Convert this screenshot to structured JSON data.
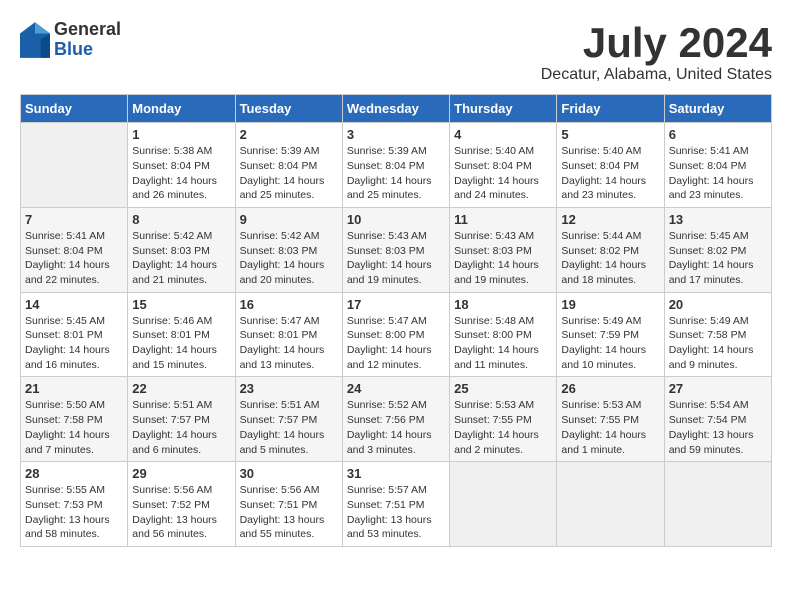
{
  "header": {
    "logo": {
      "general": "General",
      "blue": "Blue"
    },
    "title": "July 2024",
    "location": "Decatur, Alabama, United States"
  },
  "columns": [
    "Sunday",
    "Monday",
    "Tuesday",
    "Wednesday",
    "Thursday",
    "Friday",
    "Saturday"
  ],
  "weeks": [
    [
      {
        "day": "",
        "empty": true
      },
      {
        "day": "1",
        "sunrise": "Sunrise: 5:38 AM",
        "sunset": "Sunset: 8:04 PM",
        "daylight": "Daylight: 14 hours and 26 minutes."
      },
      {
        "day": "2",
        "sunrise": "Sunrise: 5:39 AM",
        "sunset": "Sunset: 8:04 PM",
        "daylight": "Daylight: 14 hours and 25 minutes."
      },
      {
        "day": "3",
        "sunrise": "Sunrise: 5:39 AM",
        "sunset": "Sunset: 8:04 PM",
        "daylight": "Daylight: 14 hours and 25 minutes."
      },
      {
        "day": "4",
        "sunrise": "Sunrise: 5:40 AM",
        "sunset": "Sunset: 8:04 PM",
        "daylight": "Daylight: 14 hours and 24 minutes."
      },
      {
        "day": "5",
        "sunrise": "Sunrise: 5:40 AM",
        "sunset": "Sunset: 8:04 PM",
        "daylight": "Daylight: 14 hours and 23 minutes."
      },
      {
        "day": "6",
        "sunrise": "Sunrise: 5:41 AM",
        "sunset": "Sunset: 8:04 PM",
        "daylight": "Daylight: 14 hours and 23 minutes."
      }
    ],
    [
      {
        "day": "7",
        "sunrise": "Sunrise: 5:41 AM",
        "sunset": "Sunset: 8:04 PM",
        "daylight": "Daylight: 14 hours and 22 minutes."
      },
      {
        "day": "8",
        "sunrise": "Sunrise: 5:42 AM",
        "sunset": "Sunset: 8:03 PM",
        "daylight": "Daylight: 14 hours and 21 minutes."
      },
      {
        "day": "9",
        "sunrise": "Sunrise: 5:42 AM",
        "sunset": "Sunset: 8:03 PM",
        "daylight": "Daylight: 14 hours and 20 minutes."
      },
      {
        "day": "10",
        "sunrise": "Sunrise: 5:43 AM",
        "sunset": "Sunset: 8:03 PM",
        "daylight": "Daylight: 14 hours and 19 minutes."
      },
      {
        "day": "11",
        "sunrise": "Sunrise: 5:43 AM",
        "sunset": "Sunset: 8:03 PM",
        "daylight": "Daylight: 14 hours and 19 minutes."
      },
      {
        "day": "12",
        "sunrise": "Sunrise: 5:44 AM",
        "sunset": "Sunset: 8:02 PM",
        "daylight": "Daylight: 14 hours and 18 minutes."
      },
      {
        "day": "13",
        "sunrise": "Sunrise: 5:45 AM",
        "sunset": "Sunset: 8:02 PM",
        "daylight": "Daylight: 14 hours and 17 minutes."
      }
    ],
    [
      {
        "day": "14",
        "sunrise": "Sunrise: 5:45 AM",
        "sunset": "Sunset: 8:01 PM",
        "daylight": "Daylight: 14 hours and 16 minutes."
      },
      {
        "day": "15",
        "sunrise": "Sunrise: 5:46 AM",
        "sunset": "Sunset: 8:01 PM",
        "daylight": "Daylight: 14 hours and 15 minutes."
      },
      {
        "day": "16",
        "sunrise": "Sunrise: 5:47 AM",
        "sunset": "Sunset: 8:01 PM",
        "daylight": "Daylight: 14 hours and 13 minutes."
      },
      {
        "day": "17",
        "sunrise": "Sunrise: 5:47 AM",
        "sunset": "Sunset: 8:00 PM",
        "daylight": "Daylight: 14 hours and 12 minutes."
      },
      {
        "day": "18",
        "sunrise": "Sunrise: 5:48 AM",
        "sunset": "Sunset: 8:00 PM",
        "daylight": "Daylight: 14 hours and 11 minutes."
      },
      {
        "day": "19",
        "sunrise": "Sunrise: 5:49 AM",
        "sunset": "Sunset: 7:59 PM",
        "daylight": "Daylight: 14 hours and 10 minutes."
      },
      {
        "day": "20",
        "sunrise": "Sunrise: 5:49 AM",
        "sunset": "Sunset: 7:58 PM",
        "daylight": "Daylight: 14 hours and 9 minutes."
      }
    ],
    [
      {
        "day": "21",
        "sunrise": "Sunrise: 5:50 AM",
        "sunset": "Sunset: 7:58 PM",
        "daylight": "Daylight: 14 hours and 7 minutes."
      },
      {
        "day": "22",
        "sunrise": "Sunrise: 5:51 AM",
        "sunset": "Sunset: 7:57 PM",
        "daylight": "Daylight: 14 hours and 6 minutes."
      },
      {
        "day": "23",
        "sunrise": "Sunrise: 5:51 AM",
        "sunset": "Sunset: 7:57 PM",
        "daylight": "Daylight: 14 hours and 5 minutes."
      },
      {
        "day": "24",
        "sunrise": "Sunrise: 5:52 AM",
        "sunset": "Sunset: 7:56 PM",
        "daylight": "Daylight: 14 hours and 3 minutes."
      },
      {
        "day": "25",
        "sunrise": "Sunrise: 5:53 AM",
        "sunset": "Sunset: 7:55 PM",
        "daylight": "Daylight: 14 hours and 2 minutes."
      },
      {
        "day": "26",
        "sunrise": "Sunrise: 5:53 AM",
        "sunset": "Sunset: 7:55 PM",
        "daylight": "Daylight: 14 hours and 1 minute."
      },
      {
        "day": "27",
        "sunrise": "Sunrise: 5:54 AM",
        "sunset": "Sunset: 7:54 PM",
        "daylight": "Daylight: 13 hours and 59 minutes."
      }
    ],
    [
      {
        "day": "28",
        "sunrise": "Sunrise: 5:55 AM",
        "sunset": "Sunset: 7:53 PM",
        "daylight": "Daylight: 13 hours and 58 minutes."
      },
      {
        "day": "29",
        "sunrise": "Sunrise: 5:56 AM",
        "sunset": "Sunset: 7:52 PM",
        "daylight": "Daylight: 13 hours and 56 minutes."
      },
      {
        "day": "30",
        "sunrise": "Sunrise: 5:56 AM",
        "sunset": "Sunset: 7:51 PM",
        "daylight": "Daylight: 13 hours and 55 minutes."
      },
      {
        "day": "31",
        "sunrise": "Sunrise: 5:57 AM",
        "sunset": "Sunset: 7:51 PM",
        "daylight": "Daylight: 13 hours and 53 minutes."
      },
      {
        "day": "",
        "empty": true
      },
      {
        "day": "",
        "empty": true
      },
      {
        "day": "",
        "empty": true
      }
    ]
  ]
}
